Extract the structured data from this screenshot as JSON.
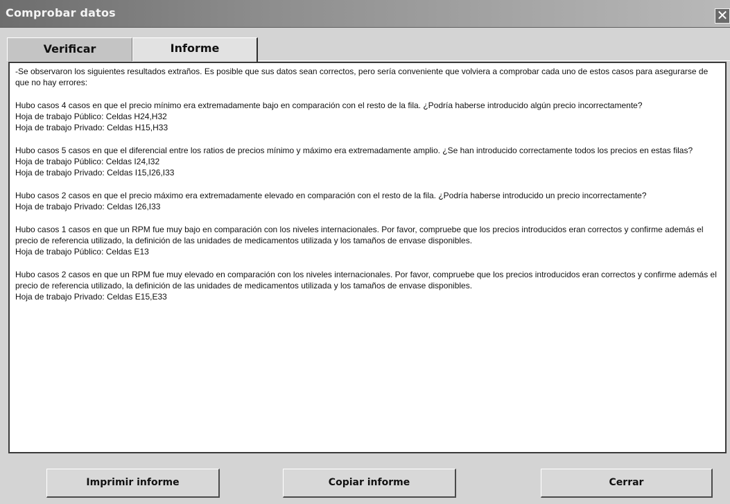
{
  "window": {
    "title": "Comprobar datos",
    "close_glyph": "✕"
  },
  "tabs": [
    {
      "label": "Verificar",
      "active": false
    },
    {
      "label": "Informe",
      "active": true
    }
  ],
  "report": {
    "intro": "-Se observaron los siguientes resultados extraños. Es posible que sus datos sean correctos, pero sería conveniente que volviera a comprobar cada uno de estos casos para asegurarse de que no hay errores:",
    "sections": [
      {
        "message": "Hubo casos  4 casos en que el precio mínimo era extremadamente bajo en comparación con el resto de la fila. ¿Podría haberse introducido algún precio incorrectamente?",
        "cells": [
          "Hoja de trabajo Público: Celdas H24,H32",
          "Hoja de trabajo Privado: Celdas H15,H33"
        ]
      },
      {
        "message": "Hubo casos  5 casos en que el diferencial entre los ratios de precios mínimo y máximo era extremadamente amplio. ¿Se han introducido correctamente todos los precios en estas filas?",
        "cells": [
          "Hoja de trabajo Público: Celdas I24,I32",
          "Hoja de trabajo Privado: Celdas I15,I26,I33"
        ]
      },
      {
        "message": "Hubo casos  2 casos en que el precio máximo era extremadamente elevado en comparación con el resto de la fila. ¿Podría haberse introducido un precio incorrectamente?",
        "cells": [
          "Hoja de trabajo Privado: Celdas I26,I33"
        ]
      },
      {
        "message": "Hubo casos  1 casos en que un RPM fue muy bajo en comparación con los niveles internacionales. Por favor, compruebe que los precios introducidos eran correctos y confirme además el precio de referencia utilizado, la definición de las unidades de medicamentos utilizada y los tamaños de envase disponibles.",
        "cells": [
          "Hoja de trabajo Público: Celdas E13"
        ]
      },
      {
        "message": "Hubo casos  2 casos en que un RPM fue muy elevado en comparación con los niveles internacionales. Por favor, compruebe que los precios introducidos eran correctos y confirme además el precio de referencia utilizado, la definición de las unidades de medicamentos utilizada y los tamaños de envase disponibles.",
        "cells": [
          "Hoja de trabajo Privado: Celdas E15,E33"
        ]
      }
    ]
  },
  "buttons": {
    "print": "Imprimir informe",
    "copy": "Copiar informe",
    "close": "Cerrar"
  }
}
